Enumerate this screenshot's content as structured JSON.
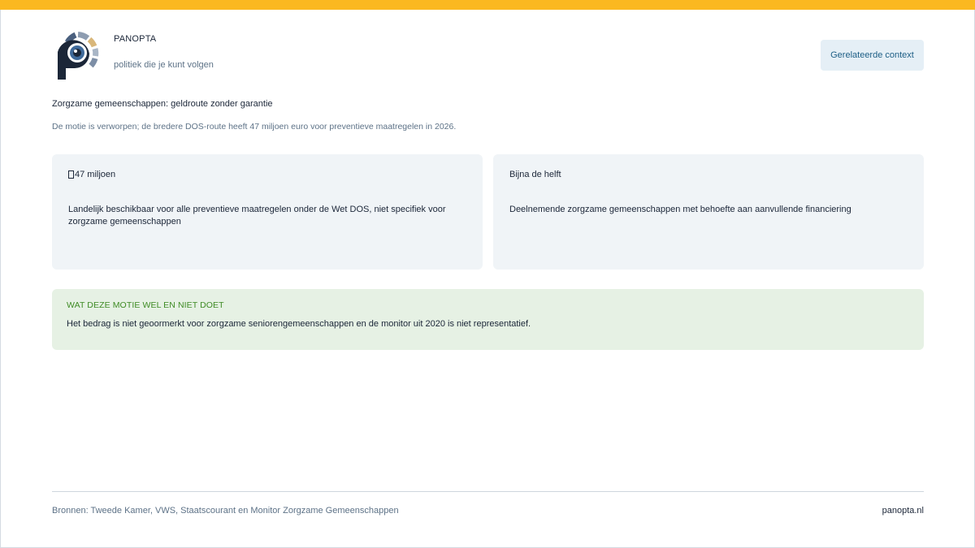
{
  "brand": {
    "logo_icon": "panopta-eye-logo-icon",
    "name": "PANOPTA",
    "tagline": "politiek die je kunt volgen"
  },
  "header": {
    "context_button_label": "Gerelateerde context"
  },
  "article": {
    "title": "Zorgzame gemeenschappen: geldroute zonder garantie",
    "subtitle": "De motie is verworpen; de bredere DOS-route heeft 47 miljoen euro voor preventieve maatregelen in 2026."
  },
  "cards": [
    {
      "stat_icon": "euro-icon",
      "stat": "47 miljoen",
      "description": "Landelijk beschikbaar voor alle preventieve maatregelen onder de Wet DOS, niet specifiek voor zorgzame gemeenschappen"
    },
    {
      "stat": "Bijna de helft",
      "description": "Deelnemende zorgzame gemeenschappen met behoefte aan aanvullende financiering"
    }
  ],
  "callout": {
    "heading": "WAT DEZE MOTIE WEL EN NIET DOET",
    "text": "Het bedrag is niet geoormerkt voor zorgzame seniorengemeenschappen en de monitor uit 2020 is niet representatief."
  },
  "footer": {
    "sources": "Bronnen: Tweede Kamer, VWS, Staatscourant en Monitor Zorgzame Gemeenschappen",
    "site": "panopta.nl"
  },
  "colors": {
    "accent_bar": "#fbb820",
    "navy": "#1b2638",
    "muted": "#5d7287",
    "button_bg": "#e5eff6",
    "callout_bg": "#e6f1e4",
    "callout_heading": "#3e8b24"
  }
}
